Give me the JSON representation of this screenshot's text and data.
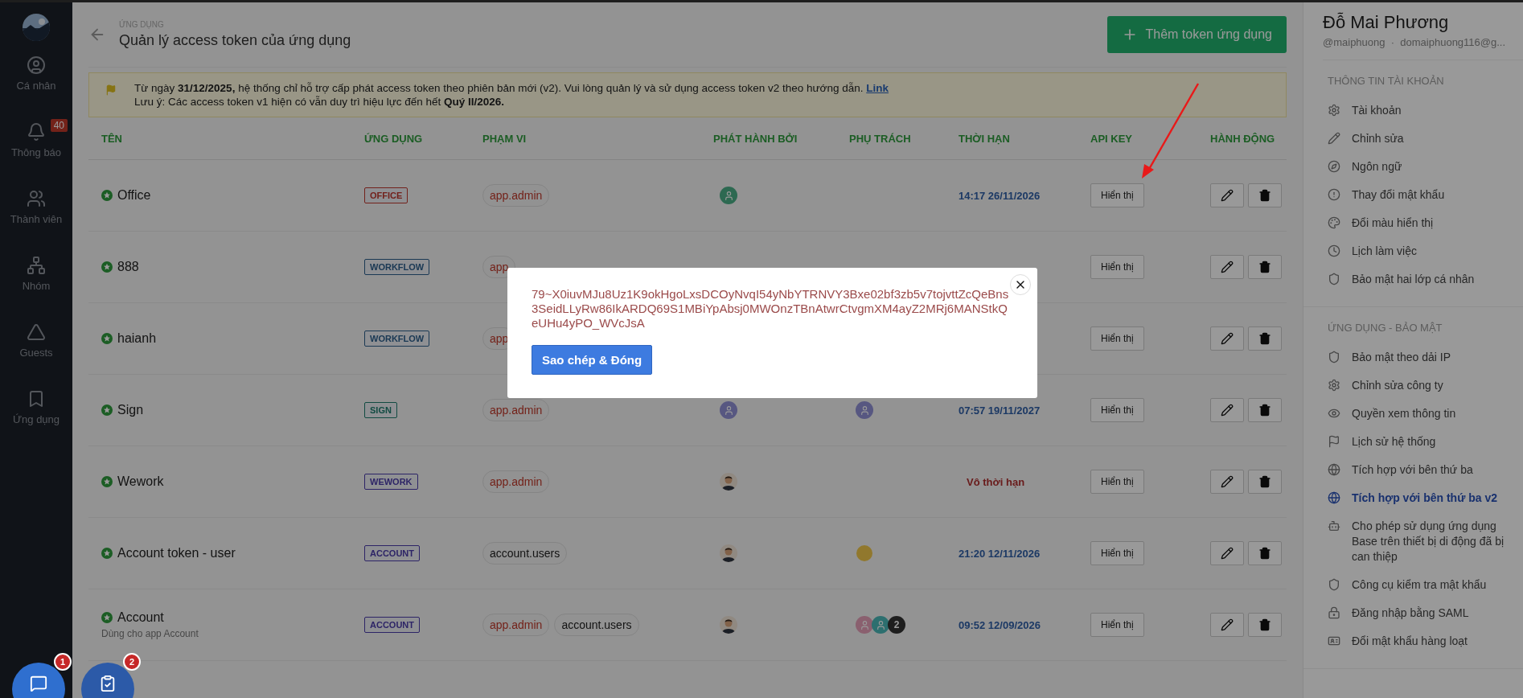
{
  "sidebar": {
    "items": [
      {
        "label": "Cá nhân"
      },
      {
        "label": "Thông báo",
        "badge": "40"
      },
      {
        "label": "Thành viên"
      },
      {
        "label": "Nhóm"
      },
      {
        "label": "Guests"
      },
      {
        "label": "Ứng dụng"
      }
    ]
  },
  "header": {
    "breadcrumb": "ỨNG DỤNG",
    "title": "Quản lý access token của ứng dụng",
    "add_button": "Thêm token ứng dụng"
  },
  "notice": {
    "text": "Từ ngày **31/12/2025,** hệ thống chỉ hỗ trợ cấp phát access token theo phiên bản mới (v2). Vui lòng quản lý và sử dụng access token v2 theo hướng dẫn.",
    "link": "Link",
    "note": "Lưu ý: Các access token v1 hiện có vẫn duy trì hiệu lực đến hết **Quý II/2026.**"
  },
  "table": {
    "columns": [
      "TÊN",
      "ỨNG DỤNG",
      "PHẠM VI",
      "PHÁT HÀNH BỞI",
      "PHỤ TRÁCH",
      "THỜI HẠN",
      "API KEY",
      "HÀNH ĐỘNG"
    ],
    "rows": [
      {
        "name": "Office",
        "app": {
          "label": "OFFICE",
          "color": "#72211b"
        },
        "scopes": [
          {
            "label": "app.admin",
            "kind": "highlighted"
          }
        ],
        "issuer": {
          "kind": "placeholder",
          "color": "#2d6951"
        },
        "owners": [],
        "expiry": {
          "kind": "date",
          "text": "14:17 26/11/2026"
        },
        "api_key": "Hiển thị"
      },
      {
        "name": "888",
        "app": {
          "label": "WORKFLOW",
          "color": "#1b3954"
        },
        "scopes": [
          {
            "label": "app",
            "kind": "highlighted"
          }
        ],
        "owners": [],
        "api_key": "Hiển thị"
      },
      {
        "name": "haianh",
        "app": {
          "label": "WORKFLOW",
          "color": "#1b3954"
        },
        "scopes": [
          {
            "label": "app",
            "kind": "highlighted"
          }
        ],
        "owners": [],
        "api_key": "Hiển thị"
      },
      {
        "name": "Sign",
        "app": {
          "label": "SIGN",
          "color": "#124b42"
        },
        "scopes": [
          {
            "label": "app.admin",
            "kind": "highlighted"
          }
        ],
        "issuer": {
          "kind": "placeholder",
          "color": "#575781"
        },
        "owners": [
          {
            "kind": "placeholder",
            "color": "#575781"
          }
        ],
        "expiry": {
          "kind": "date",
          "text": "07:57 19/11/2027"
        },
        "api_key": "Hiển thị"
      },
      {
        "name": "Wework",
        "app": {
          "label": "WEWORK",
          "color": "#2d2466"
        },
        "scopes": [
          {
            "label": "app.admin",
            "kind": "highlighted"
          }
        ],
        "issuer": {
          "kind": "person"
        },
        "owners": [],
        "expiry": {
          "kind": "never",
          "text": "Vô thời hạn"
        },
        "api_key": "Hiển thị"
      },
      {
        "name": "Account token - user",
        "app": {
          "label": "ACCOUNT",
          "color": "#2d2466"
        },
        "scopes": [
          {
            "label": "account.users",
            "kind": "plain"
          }
        ],
        "issuer": {
          "kind": "person"
        },
        "owners": [
          {
            "kind": "emoji"
          }
        ],
        "expiry": {
          "kind": "date",
          "text": "21:20 12/11/2026"
        },
        "api_key": "Hiển thị"
      },
      {
        "name": "Account",
        "description": "Dùng cho app Account",
        "app": {
          "label": "ACCOUNT",
          "color": "#2d2466"
        },
        "scopes": [
          {
            "label": "app.admin",
            "kind": "highlighted"
          },
          {
            "label": "account.users",
            "kind": "plain"
          }
        ],
        "issuer": {
          "kind": "person"
        },
        "owners": [
          {
            "kind": "placeholder",
            "color": "#8a606f"
          },
          {
            "kind": "placeholder",
            "color": "#2d6f6f"
          },
          {
            "kind": "count",
            "text": "2"
          }
        ],
        "expiry": {
          "kind": "date",
          "text": "09:52 12/09/2026"
        },
        "api_key": "Hiển thị"
      }
    ]
  },
  "profile": {
    "name": "Đỗ Mai Phương",
    "handle": "@maiphuong  ·  domaiphuong116@g...",
    "sections": [
      {
        "title": "THÔNG TIN TÀI KHOẢN",
        "items": [
          {
            "label": "Tài khoản",
            "selected": false
          },
          {
            "label": "Chỉnh sửa",
            "selected": false
          },
          {
            "label": "Ngôn ngữ",
            "selected": false
          },
          {
            "label": "Thay đổi mật khẩu",
            "selected": false
          },
          {
            "label": "Đổi màu hiển thị",
            "selected": false
          },
          {
            "label": "Lịch làm việc",
            "selected": false
          },
          {
            "label": "Bảo mật hai lớp cá nhân",
            "selected": false
          }
        ]
      },
      {
        "title": "ỨNG DỤNG - BẢO MẬT",
        "items": [
          {
            "label": "Bảo mật theo dải IP",
            "selected": false
          },
          {
            "label": "Chỉnh sửa công ty",
            "selected": false
          },
          {
            "label": "Quyền xem thông tin",
            "selected": false
          },
          {
            "label": "Lịch sử hệ thống",
            "selected": false
          },
          {
            "label": "Tích hợp với bên thứ ba",
            "selected": false
          },
          {
            "label": "Tích hợp với bên thứ ba v2",
            "selected": true
          },
          {
            "label": "Cho phép sử dụng ứng dụng Base trên thiết bị di động đã bị can thiệp",
            "selected": false
          },
          {
            "label": "Công cụ kiểm tra mật khẩu",
            "selected": false
          },
          {
            "label": "Đăng nhập bằng SAML",
            "selected": false
          },
          {
            "label": "Đổi mật khẩu hàng loạt",
            "selected": false
          }
        ]
      }
    ]
  },
  "modal": {
    "token": "79~X0iuvMJu8Uz1K9okHgoLxsDCOyNvqI54yNbYTRNVY3Bxe02bf3zb5v7tojvttZcQeBns3SeidLLyRw86IkARDQ69S1MBiYpAbsj0MWOnzTBnAtwrCtvgmXM4ayZ2MRj6MANStkQeUHu4yPO_WVcJsA",
    "button": "Sao chép & Đóng"
  },
  "floating": [
    {
      "kind": "chat",
      "badge": "1"
    },
    {
      "kind": "task",
      "badge": "2"
    }
  ]
}
